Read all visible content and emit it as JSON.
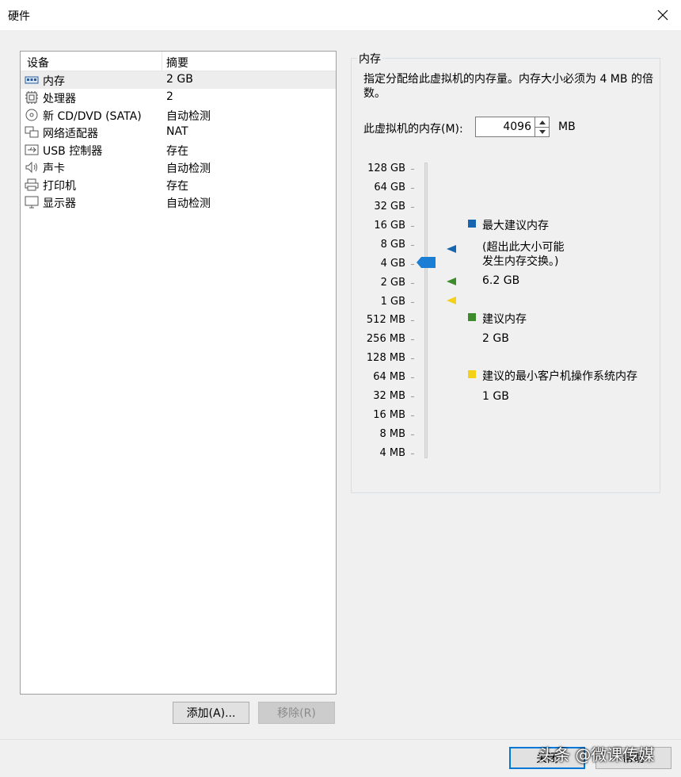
{
  "window": {
    "title": "硬件"
  },
  "device_list": {
    "headers": {
      "device": "设备",
      "summary": "摘要"
    },
    "items": [
      {
        "name": "内存",
        "summary": "2 GB",
        "icon": "memory-icon"
      },
      {
        "name": "处理器",
        "summary": "2",
        "icon": "processor-icon"
      },
      {
        "name": "新 CD/DVD (SATA)",
        "summary": "自动检测",
        "icon": "cd-dvd-icon"
      },
      {
        "name": "网络适配器",
        "summary": "NAT",
        "icon": "network-adapter-icon"
      },
      {
        "name": "USB 控制器",
        "summary": "存在",
        "icon": "usb-icon"
      },
      {
        "name": "声卡",
        "summary": "自动检测",
        "icon": "sound-card-icon"
      },
      {
        "name": "打印机",
        "summary": "存在",
        "icon": "printer-icon"
      },
      {
        "name": "显示器",
        "summary": "自动检测",
        "icon": "monitor-icon"
      }
    ]
  },
  "buttons": {
    "add": "添加(A)...",
    "remove": "移除(R)"
  },
  "memory": {
    "group_title": "内存",
    "description": "指定分配给此虚拟机的内存量。内存大小必须为 4 MB 的倍数。",
    "field_label": "此虚拟机的内存(M):",
    "value": "4096",
    "unit": "MB",
    "scale": [
      "128 GB",
      "64 GB",
      "32 GB",
      "16 GB",
      "8 GB",
      "4 GB",
      "2 GB",
      "1 GB",
      "512 MB",
      "256 MB",
      "128 MB",
      "64 MB",
      "32 MB",
      "16 MB",
      "8 MB",
      "4 MB"
    ],
    "legend": {
      "max_title": "最大建议内存",
      "max_note_line1": "(超出此大小可能",
      "max_note_line2": "发生内存交换。)",
      "max_value": "6.2 GB",
      "rec_title": "建议内存",
      "rec_value": "2 GB",
      "min_title": "建议的最小客户机操作系统内存",
      "min_value": "1 GB"
    },
    "colors": {
      "max": "#1565b0",
      "rec": "#3d8b2a",
      "min": "#f3d01a",
      "thumb": "#1a7fd4"
    }
  },
  "dialog_buttons": {
    "close": "关闭",
    "help": "帮助"
  },
  "watermark": "头条 @微课传媒"
}
